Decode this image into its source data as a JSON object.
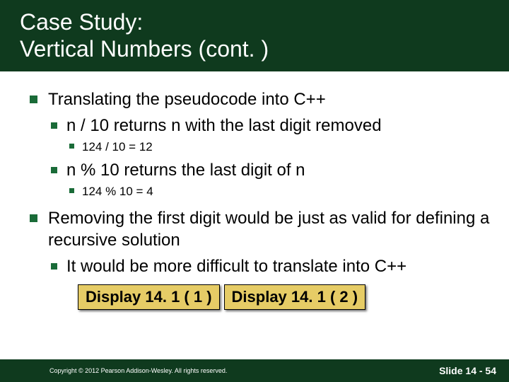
{
  "title": {
    "line1": "Case Study:",
    "line2": "Vertical Numbers  (cont. )"
  },
  "bullets": {
    "item1": {
      "text": "Translating the pseudocode into C++",
      "sub1": {
        "text": "n / 10  returns n with the last digit removed",
        "ex": "124 / 10 = 12"
      },
      "sub2": {
        "text": "n % 10 returns the last digit of n",
        "ex": "124 % 10 = 4"
      }
    },
    "item2": {
      "text": "Removing the first digit would be just as valid for defining a recursive solution",
      "sub1": {
        "text": "It would be more difficult to translate into C++"
      }
    }
  },
  "buttons": {
    "b1": "Display 14. 1 ( 1 )",
    "b2": "Display 14. 1 ( 2 )"
  },
  "footer": {
    "copyright": "Copyright © 2012 Pearson Addison-Wesley.  All rights reserved.",
    "slide": "Slide 14 - 54"
  }
}
